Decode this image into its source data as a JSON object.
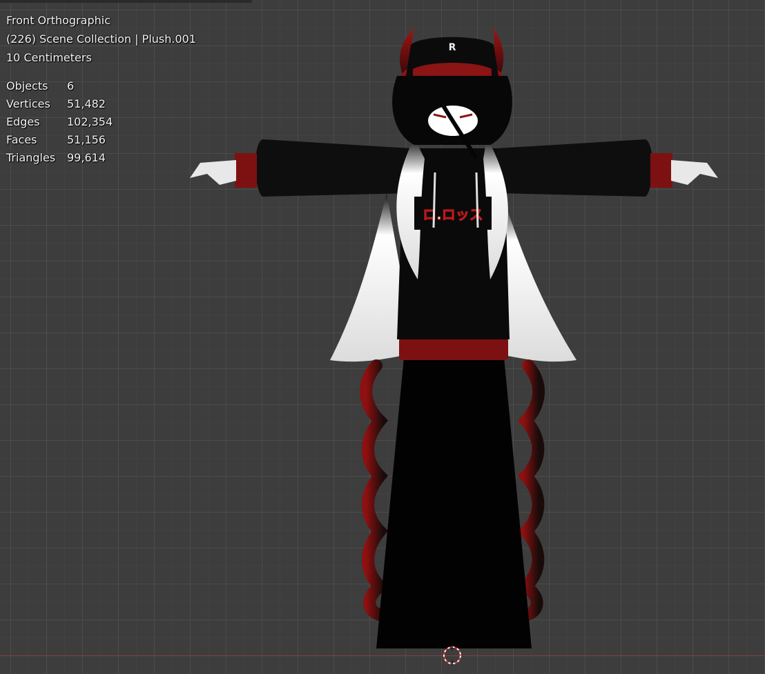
{
  "viewport": {
    "view_name": "Front Orthographic",
    "collection": "(226) Scene Collection | Plush.001",
    "scale": "10 Centimeters"
  },
  "stats": [
    {
      "label": "Objects",
      "value": "6"
    },
    {
      "label": "Vertices",
      "value": "51,482"
    },
    {
      "label": "Edges",
      "value": "102,354"
    },
    {
      "label": "Faces",
      "value": "51,156"
    },
    {
      "label": "Triangles",
      "value": "99,614"
    }
  ],
  "model": {
    "hoodie_print": "ロ.ロッス",
    "cap_letter": "R"
  },
  "colors": {
    "background": "#3d3d3d",
    "grid": "#555555",
    "text": "#f2f2f2",
    "accent_red": "#8b1414",
    "hair_white": "#ececec",
    "x_axis": "#8a3b3b"
  },
  "icons": {
    "origin": "3d-cursor-icon"
  }
}
